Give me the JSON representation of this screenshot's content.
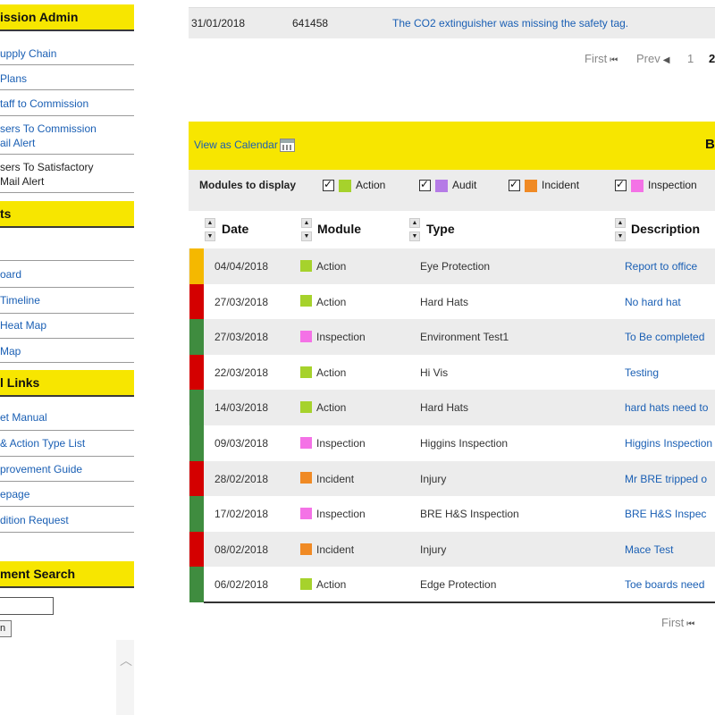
{
  "colors": {
    "accent_yellow": "#f7e600",
    "link_blue": "#1a5fb4",
    "action": "#a6d22c",
    "audit": "#b57be6",
    "incident": "#f08a24",
    "inspection": "#f472e6",
    "status_amber": "#f5b800",
    "status_red": "#d40000",
    "status_green": "#3f8c3f"
  },
  "sidebar": {
    "sections": [
      {
        "title": "ission Admin",
        "items": [
          "upply Chain",
          " Plans",
          "taff to Commission",
          "sers To Commission\nail Alert",
          "sers To Satisfactory\nMail Alert"
        ]
      },
      {
        "title": "ts",
        "items": [
          "",
          "oard",
          " Timeline",
          " Heat Map",
          "Map"
        ]
      },
      {
        "title": "l Links",
        "items": [
          "et Manual",
          " & Action Type List",
          "provement Guide",
          "epage",
          "dition Request"
        ]
      },
      {
        "title": "ment Search"
      }
    ],
    "search_button_label": "n",
    "search_value": ""
  },
  "top_table": {
    "date": "31/01/2018",
    "ref": "641458",
    "description": "The CO2 extinguisher was missing the safety tag."
  },
  "pager_top": {
    "first": "First",
    "prev": "Prev",
    "page1": "1",
    "page2": "2"
  },
  "pager_bottom": {
    "first": "First"
  },
  "panel": {
    "calendar_link": "View as Calendar",
    "title": "B"
  },
  "modules": {
    "label": "Modules to display",
    "items": [
      {
        "name": "Action",
        "icon": "action-square-icon"
      },
      {
        "name": "Audit",
        "icon": "audit-square-icon"
      },
      {
        "name": "Incident",
        "icon": "incident-square-icon"
      },
      {
        "name": "Inspection",
        "icon": "inspection-square-icon"
      }
    ]
  },
  "table": {
    "headers": [
      "Date",
      "Module",
      "Type",
      "Description"
    ],
    "rows": [
      {
        "status": "amber",
        "date": "04/04/2018",
        "module": "Action",
        "type": "Eye Protection",
        "description": "Report to office"
      },
      {
        "status": "red",
        "date": "27/03/2018",
        "module": "Action",
        "type": "Hard Hats",
        "description": "No hard hat"
      },
      {
        "status": "green",
        "date": "27/03/2018",
        "module": "Inspection",
        "type": "Environment Test1",
        "description": "To Be completed"
      },
      {
        "status": "red",
        "date": "22/03/2018",
        "module": "Action",
        "type": "Hi Vis",
        "description": "Testing"
      },
      {
        "status": "green",
        "date": "14/03/2018",
        "module": "Action",
        "type": "Hard Hats",
        "description": "hard hats need to"
      },
      {
        "status": "green",
        "date": "09/03/2018",
        "module": "Inspection",
        "type": "Higgins Inspection",
        "description": "Higgins Inspection"
      },
      {
        "status": "red",
        "date": "28/02/2018",
        "module": "Incident",
        "type": "Injury",
        "description": "Mr BRE tripped o"
      },
      {
        "status": "green",
        "date": "17/02/2018",
        "module": "Inspection",
        "type": "BRE H&S Inspection",
        "description": "BRE H&S Inspec"
      },
      {
        "status": "red",
        "date": "08/02/2018",
        "module": "Incident",
        "type": "Injury",
        "description": "Mace Test"
      },
      {
        "status": "green",
        "date": "06/02/2018",
        "module": "Action",
        "type": "Edge Protection",
        "description": "Toe boards need"
      }
    ]
  }
}
